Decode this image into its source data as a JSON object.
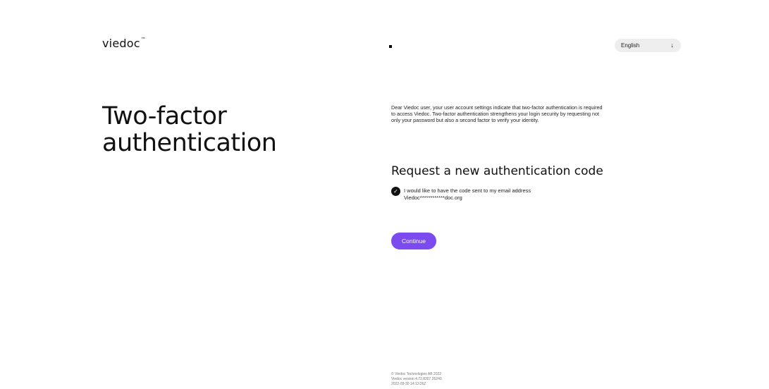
{
  "header": {
    "logo_text": "viedoc",
    "logo_mark": "™",
    "language": {
      "selected": "English",
      "icon": "arrow-down-icon"
    }
  },
  "main": {
    "title_line1": "Two-factor",
    "title_line2": "authentication",
    "intro": "Dear Viedoc user, your user account settings indicate that two-factor authentication is required to access Viedoc. Two-factor authentication strengthens your login security by requesting not only your password but also a second factor to verify your identity.",
    "subtitle": "Request a new authentication code",
    "option": {
      "checked": true,
      "line1": "I would like to have the code sent to my email address",
      "line2": "Viedoc************doc.org"
    },
    "continue_label": "Continue"
  },
  "footer": {
    "copyright": "© Viedoc Technologies AB 2022",
    "version": "Viedoc  version 4.72.8307.26240",
    "timestamp": "2022-09-30 14:13:26Z"
  },
  "colors": {
    "accent": "#7b4bf0",
    "text": "#1a1a1a",
    "language_bg": "#eeeeee"
  }
}
